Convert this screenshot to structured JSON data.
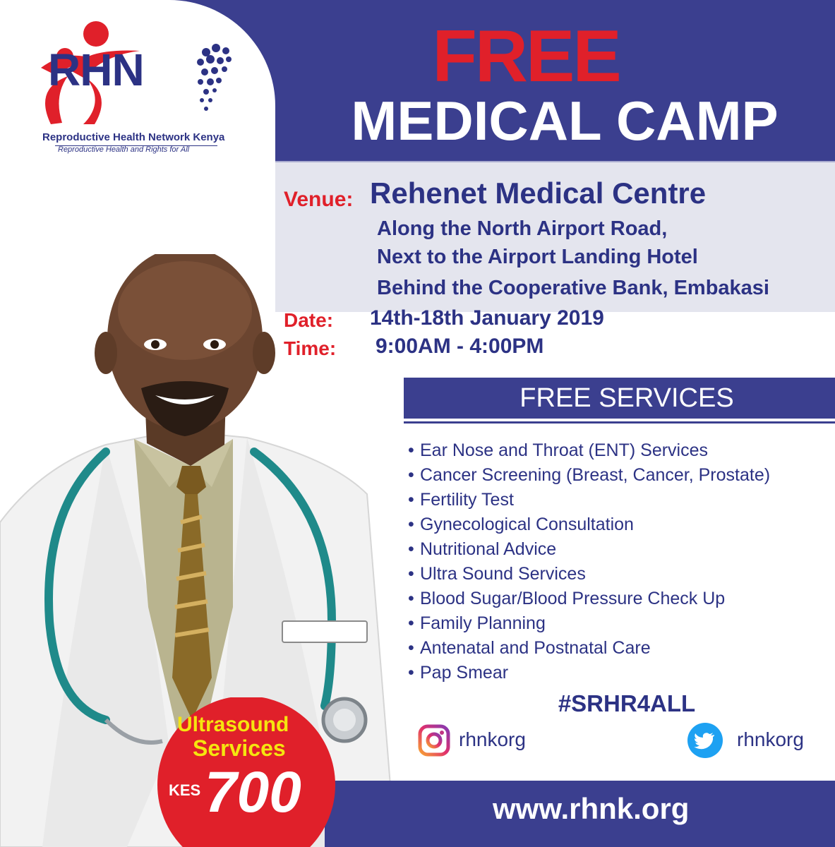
{
  "logo": {
    "wordmark": "RHN",
    "organization": "Reproductive Health Network Kenya",
    "tagline": "Reproductive Health and Rights for All"
  },
  "headline": {
    "line1": "FREE",
    "line2": "MEDICAL CAMP"
  },
  "details": {
    "venue_label": "Venue:",
    "venue_name": "Rehenet Medical Centre",
    "address_line1": "Along the North Airport Road,",
    "address_line2": "Next to the Airport Landing Hotel",
    "address_line3": "Behind the Cooperative Bank, Embakasi",
    "date_label": "Date:",
    "date_value": "14th-18th January 2019",
    "time_label": "Time:",
    "time_value": "9:00AM - 4:00PM"
  },
  "services": {
    "heading": "FREE SERVICES",
    "items": [
      "Ear Nose and Throat (ENT) Services",
      "Cancer Screening (Breast, Cancer, Prostate)",
      "Fertility Test",
      "Gynecological Consultation",
      "Nutritional Advice",
      "Ultra Sound Services",
      "Blood Sugar/Blood Pressure Check Up",
      "Family Planning",
      "Antenatal and Postnatal Care",
      "Pap Smear"
    ]
  },
  "hashtag": "#SRHR4ALL",
  "social": {
    "instagram_handle": "rhnkorg",
    "twitter_handle": "rhnkorg",
    "instagram_icon": "instagram-icon",
    "twitter_icon": "twitter-bird-icon"
  },
  "footer": {
    "website": "www.rhnk.org"
  },
  "badge": {
    "line1": "Ultrasound",
    "line2": "Services",
    "currency": "KES",
    "price": "700"
  },
  "colors": {
    "navy": "#3b3f8f",
    "red": "#e0202a",
    "light_band": "#e4e5ee",
    "badge_yellow": "#f5e50f"
  }
}
